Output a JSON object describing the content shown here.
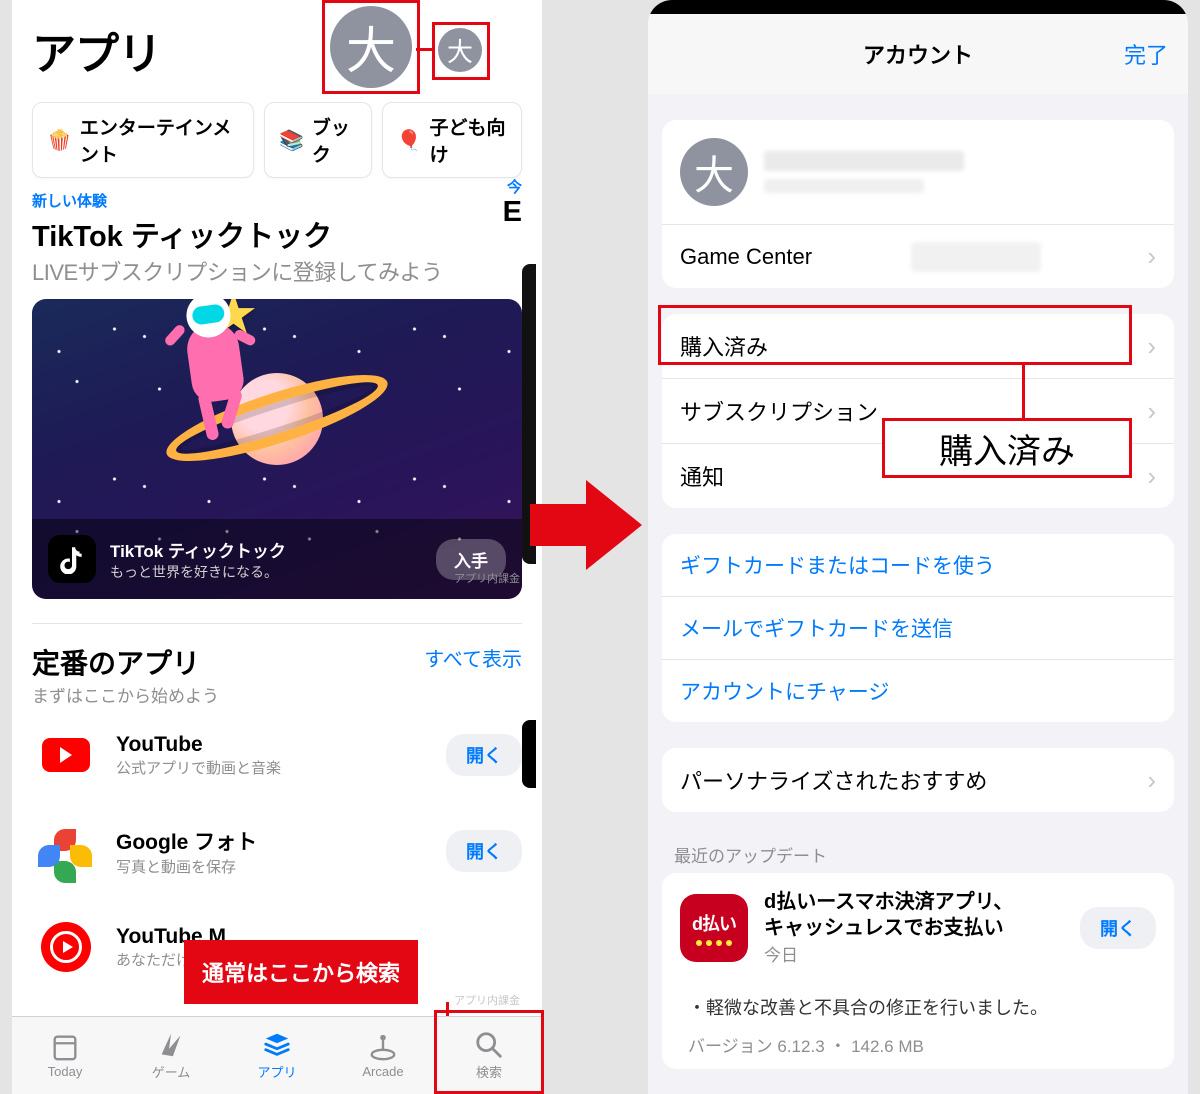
{
  "avatar_char": "大",
  "left": {
    "title": "アプリ",
    "chips": [
      {
        "icon": "🍿",
        "label": "エンターテインメント"
      },
      {
        "icon": "📚",
        "label": "ブック"
      },
      {
        "icon": "🎈",
        "label": "子ども向け"
      }
    ],
    "promo": {
      "tag": "新しい体験",
      "today": "今",
      "name": "TikTok ティックトック",
      "sub": "LIVEサブスクリプションに登録してみよう",
      "footer_title": "TikTok ティックトック",
      "footer_sub": "もっと世界を好きになる。",
      "get": "入手",
      "iap": "アプリ内課金"
    },
    "peek_letter": "E",
    "section": {
      "title": "定番のアプリ",
      "sub": "まずはここから始めよう",
      "link": "すべて表示"
    },
    "apps": [
      {
        "name": "YouTube",
        "sub": "公式アプリで動画と音楽",
        "btn": "開く"
      },
      {
        "name": "Google フォト",
        "sub": "写真と動画を保存",
        "btn": "開く"
      },
      {
        "name": "YouTube M",
        "sub": "あなただけの",
        "btn": ""
      }
    ],
    "iap_hint": "アプリ内課金",
    "tooltip": "通常はここから検索",
    "tabs": [
      {
        "label": "Today"
      },
      {
        "label": "ゲーム"
      },
      {
        "label": "アプリ"
      },
      {
        "label": "Arcade"
      },
      {
        "label": "検索"
      }
    ]
  },
  "right": {
    "nav_title": "アカウント",
    "done": "完了",
    "game_center": "Game Center",
    "rows": {
      "purchased": "購入済み",
      "subscription": "サブスクリプション",
      "notification": "通知"
    },
    "callout": "購入済み",
    "links": [
      "ギフトカードまたはコードを使う",
      "メールでギフトカードを送信",
      "アカウントにチャージ"
    ],
    "personalized": "パーソナライズされたおすすめ",
    "recent_header": "最近のアップデート",
    "update": {
      "icon_text": "d払い",
      "title1": "d払いースマホ決済アプリ、",
      "title2": "キャッシュレスでお支払い",
      "date": "今日",
      "btn": "開く",
      "note": "・軽微な改善と不具合の修正を行いました。",
      "version": "バージョン 6.12.3 ・ 142.6 MB"
    }
  }
}
